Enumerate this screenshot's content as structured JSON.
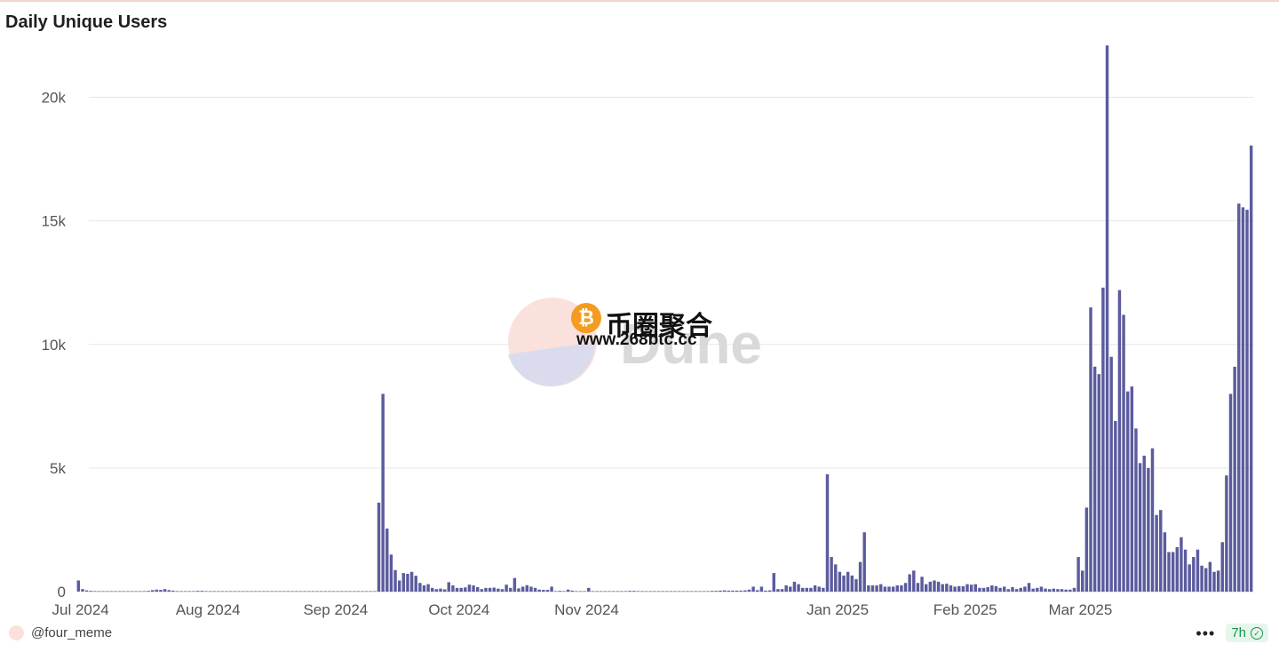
{
  "title": "Daily Unique Users",
  "footer": {
    "user": "@four_meme",
    "more": "•••",
    "refresh": "7h"
  },
  "watermark": {
    "brand": "币圈聚合",
    "url": "www.268btc.cc",
    "coin_glyph": "₿",
    "dune": "Dune"
  },
  "colors": {
    "bar": "#5b5b9e",
    "grid": "#e6e6e6",
    "axis_text": "#555555"
  },
  "chart_data": {
    "type": "bar",
    "title": "Daily Unique Users",
    "xlabel": "",
    "ylabel": "",
    "ylim": [
      0,
      22500
    ],
    "yticks": [
      0,
      5000,
      10000,
      15000,
      20000
    ],
    "ytick_labels": [
      "0",
      "5k",
      "10k",
      "15k",
      "20k"
    ],
    "xticks": [
      "2024-07-01",
      "2024-08-01",
      "2024-09-01",
      "2024-10-01",
      "2024-11-01",
      "2025-01-01",
      "2025-02-01",
      "2025-03-01"
    ],
    "xtick_labels": [
      "Jul 2024",
      "Aug 2024",
      "Sep 2024",
      "Oct 2024",
      "Nov 2024",
      "Jan 2025",
      "Feb 2025",
      "Mar 2025"
    ],
    "start_date": "2024-06-30",
    "grid": true,
    "series": [
      {
        "values": [
          450,
          100,
          50,
          30,
          20,
          20,
          20,
          20,
          20,
          20,
          20,
          20,
          20,
          20,
          20,
          20,
          20,
          30,
          60,
          80,
          70,
          100,
          60,
          40,
          20,
          20,
          20,
          20,
          20,
          30,
          30,
          20,
          20,
          20,
          20,
          20,
          20,
          20,
          20,
          20,
          20,
          20,
          20,
          20,
          20,
          20,
          20,
          20,
          20,
          20,
          20,
          20,
          20,
          20,
          20,
          20,
          20,
          20,
          20,
          20,
          20,
          20,
          20,
          20,
          20,
          20,
          20,
          20,
          20,
          20,
          20,
          20,
          20,
          3600,
          8000,
          2550,
          1500,
          870,
          450,
          750,
          720,
          800,
          640,
          350,
          250,
          300,
          150,
          100,
          120,
          90,
          380,
          250,
          150,
          150,
          170,
          280,
          250,
          180,
          100,
          150,
          150,
          160,
          120,
          100,
          280,
          150,
          550,
          130,
          200,
          260,
          200,
          150,
          80,
          70,
          70,
          200,
          20,
          30,
          20,
          80,
          40,
          20,
          20,
          20,
          150,
          20,
          20,
          20,
          20,
          20,
          20,
          20,
          20,
          20,
          30,
          30,
          20,
          20,
          20,
          20,
          20,
          20,
          20,
          20,
          20,
          20,
          20,
          20,
          20,
          20,
          20,
          20,
          20,
          20,
          30,
          30,
          40,
          50,
          40,
          40,
          40,
          40,
          50,
          80,
          200,
          60,
          200,
          40,
          50,
          750,
          100,
          100,
          250,
          200,
          400,
          300,
          150,
          150,
          150,
          250,
          200,
          150,
          4750,
          1400,
          1100,
          800,
          650,
          800,
          650,
          500,
          1200,
          2400,
          250,
          250,
          250,
          300,
          200,
          200,
          200,
          250,
          250,
          350,
          700,
          850,
          350,
          600,
          300,
          400,
          450,
          400,
          300,
          320,
          250,
          200,
          220,
          220,
          300,
          280,
          300,
          150,
          150,
          180,
          250,
          220,
          150,
          200,
          100,
          180,
          100,
          150,
          200,
          350,
          120,
          150,
          200,
          120,
          100,
          120,
          100,
          100,
          80,
          80,
          150,
          1400,
          850,
          3400,
          11500,
          9100,
          8800,
          12300,
          22100,
          9500,
          6900,
          12200,
          11200,
          8100,
          8300,
          6600,
          5200,
          5500,
          5000,
          5800,
          3100,
          3300,
          2400,
          1600,
          1600,
          1800,
          2200,
          1700,
          1100,
          1400,
          1700,
          1050,
          950,
          1200,
          800,
          850,
          2000,
          4700,
          8000,
          9100,
          15700,
          15550,
          15450,
          18050
        ]
      }
    ]
  }
}
